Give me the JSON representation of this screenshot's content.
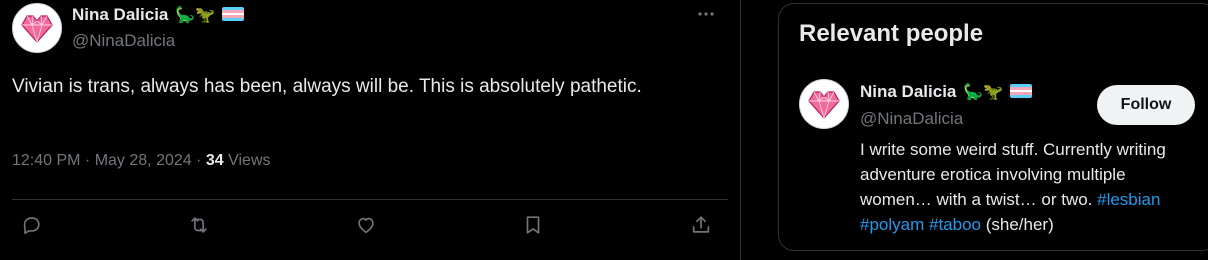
{
  "tweet": {
    "author": {
      "name": "Nina Dalicia",
      "handle": "@NinaDalicia",
      "emoji": "🦕🦖"
    },
    "more_icon": "more-horizontal-icon",
    "text": "Vivian is trans, always has been, always will be. This is absolutely pathetic.",
    "time": "12:40 PM · May 28, 2024 · ",
    "views_count": "34",
    "views_label": " Views",
    "actions": [
      {
        "name": "reply",
        "icon": "reply-icon"
      },
      {
        "name": "repost",
        "icon": "repost-icon"
      },
      {
        "name": "like",
        "icon": "heart-icon"
      },
      {
        "name": "bookmark",
        "icon": "bookmark-icon"
      },
      {
        "name": "share",
        "icon": "share-icon"
      }
    ]
  },
  "sidebar": {
    "title": "Relevant people",
    "person": {
      "name": "Nina Dalicia",
      "handle": "@NinaDalicia",
      "emoji": "🦕🦖",
      "follow_label": "Follow",
      "bio_text": "I write some weird stuff. Currently writing adventure erotica involving multiple women… with a twist… or two. ",
      "bio_tags": [
        "#lesbian",
        "#polyam",
        "#taboo"
      ],
      "bio_suffix": "(she/her)"
    }
  },
  "colors": {
    "background": "#000000",
    "text_primary": "#e7e9ea",
    "text_secondary": "#71767b",
    "border": "#2f3336",
    "link": "#1d9bf0",
    "follow_button": "#eff3f4",
    "flag_blue": "#5bcefa",
    "flag_pink": "#f5a9b8",
    "flag_white": "#ffffff"
  }
}
